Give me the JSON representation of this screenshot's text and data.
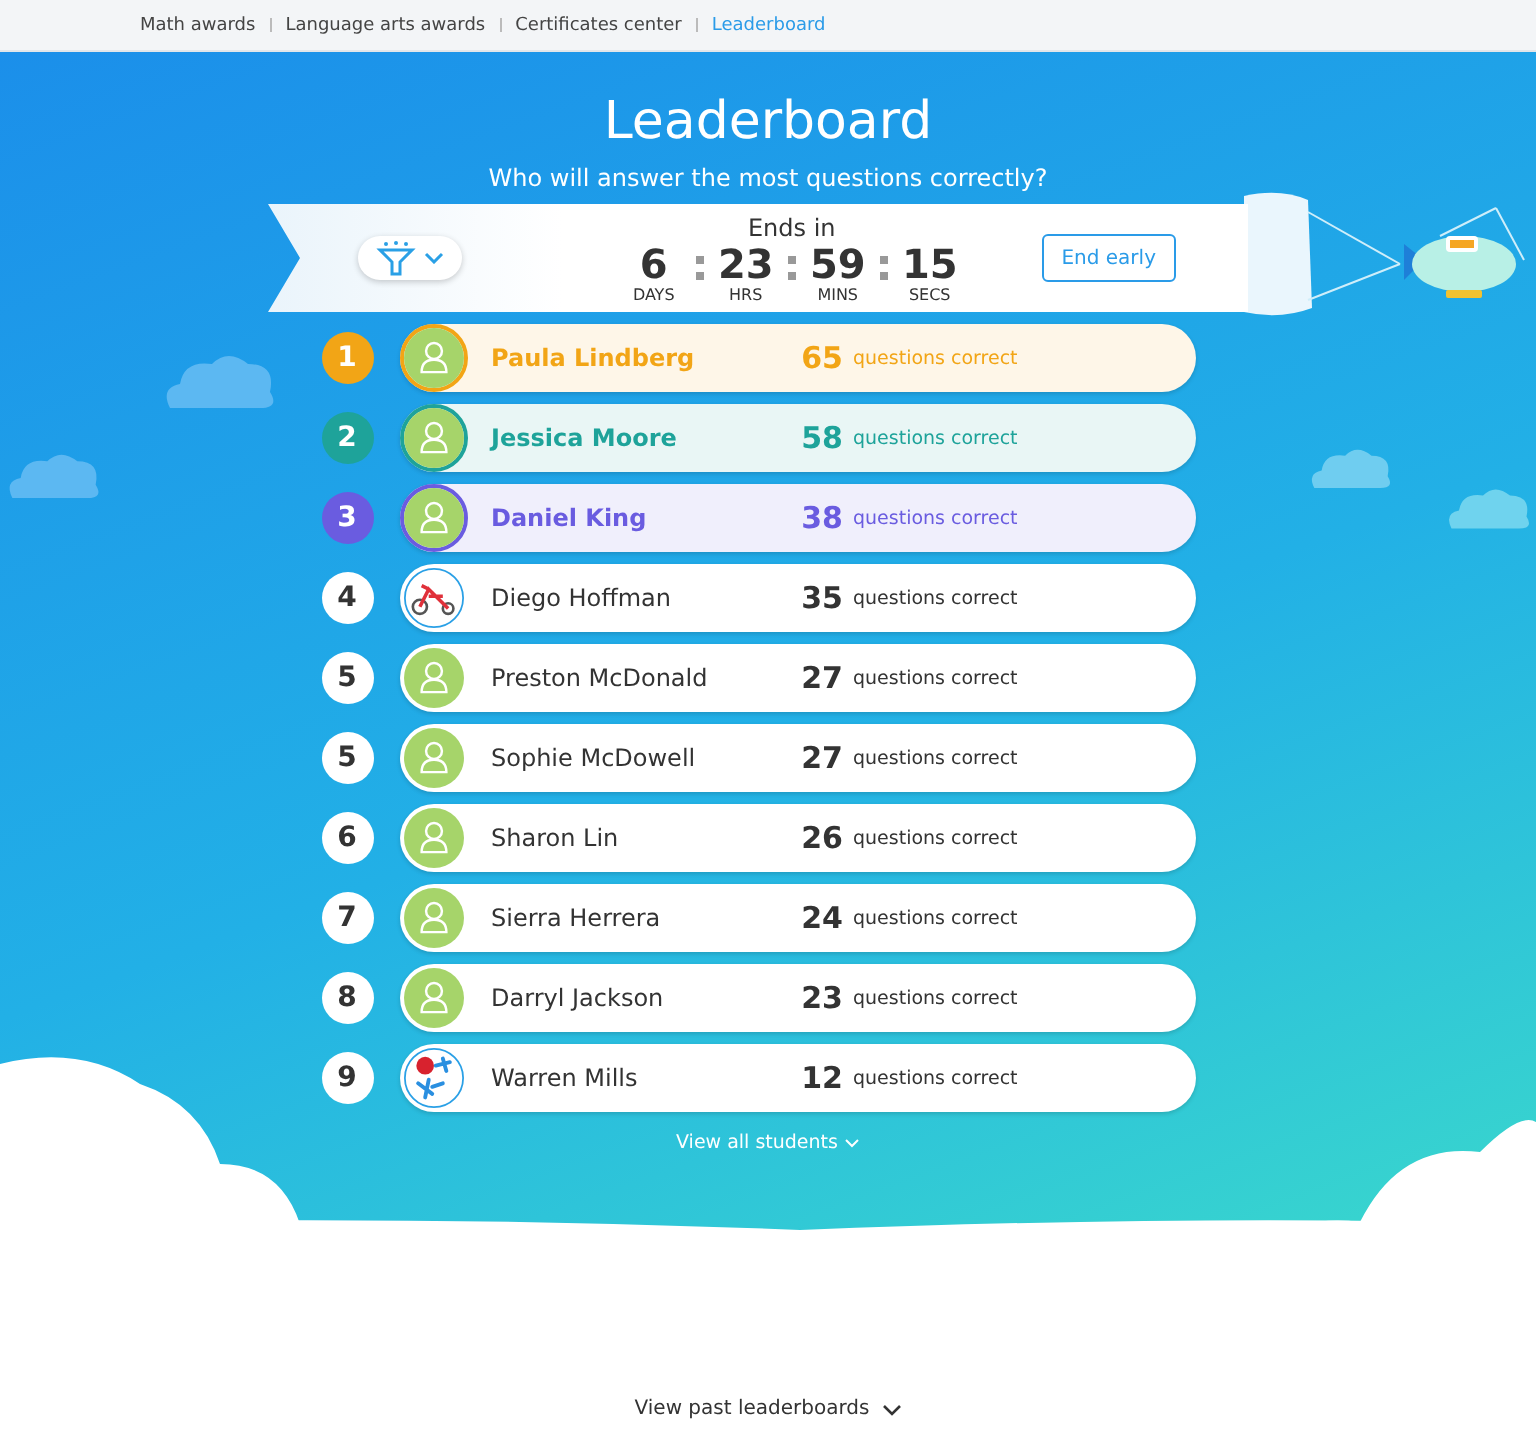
{
  "nav": {
    "links": [
      {
        "label": "Math awards",
        "selected": false
      },
      {
        "label": "Language arts awards",
        "selected": false
      },
      {
        "label": "Certificates center",
        "selected": false
      },
      {
        "label": "Leaderboard",
        "selected": true
      }
    ]
  },
  "title": "Leaderboard",
  "subtitle": "Who will answer the most questions correctly?",
  "countdown": {
    "heading": "Ends in",
    "units": [
      {
        "value": "6",
        "label": "DAYS"
      },
      {
        "value": "23",
        "label": "HRS"
      },
      {
        "value": "59",
        "label": "MINS"
      },
      {
        "value": "15",
        "label": "SECS"
      }
    ]
  },
  "end_button": "End early",
  "rows": [
    {
      "rank": "1",
      "name": "Paula Lindberg",
      "score": "65",
      "unit": "questions correct",
      "kind": "top",
      "color": "#f2a516",
      "avatar": {
        "kind": "person"
      }
    },
    {
      "rank": "2",
      "name": "Jessica Moore",
      "score": "58",
      "unit": "questions correct",
      "kind": "top",
      "color": "#1ea39a",
      "avatar": {
        "kind": "person"
      }
    },
    {
      "rank": "3",
      "name": "Daniel King",
      "score": "38",
      "unit": "questions correct",
      "kind": "top",
      "color": "#6a5ce0",
      "avatar": {
        "kind": "person"
      }
    },
    {
      "rank": "4",
      "name": "Diego Hoffman",
      "score": "35",
      "unit": "questions correct",
      "kind": "plain",
      "avatar": {
        "kind": "tricycle"
      }
    },
    {
      "rank": "5",
      "name": "Preston McDonald",
      "score": "27",
      "unit": "questions correct",
      "kind": "plain",
      "avatar": {
        "kind": "person"
      }
    },
    {
      "rank": "5",
      "name": "Sophie McDowell",
      "score": "27",
      "unit": "questions correct",
      "kind": "plain",
      "avatar": {
        "kind": "person"
      }
    },
    {
      "rank": "6",
      "name": "Sharon Lin",
      "score": "26",
      "unit": "questions correct",
      "kind": "plain",
      "avatar": {
        "kind": "person"
      }
    },
    {
      "rank": "7",
      "name": "Sierra Herrera",
      "score": "24",
      "unit": "questions correct",
      "kind": "plain",
      "avatar": {
        "kind": "person"
      }
    },
    {
      "rank": "8",
      "name": "Darryl Jackson",
      "score": "23",
      "unit": "questions correct",
      "kind": "plain",
      "avatar": {
        "kind": "person"
      }
    },
    {
      "rank": "9",
      "name": "Warren Mills",
      "score": "12",
      "unit": "questions correct",
      "kind": "plain",
      "avatar": {
        "kind": "molecule"
      }
    }
  ],
  "view_all": "View all students",
  "view_past": "View past leaderboards"
}
